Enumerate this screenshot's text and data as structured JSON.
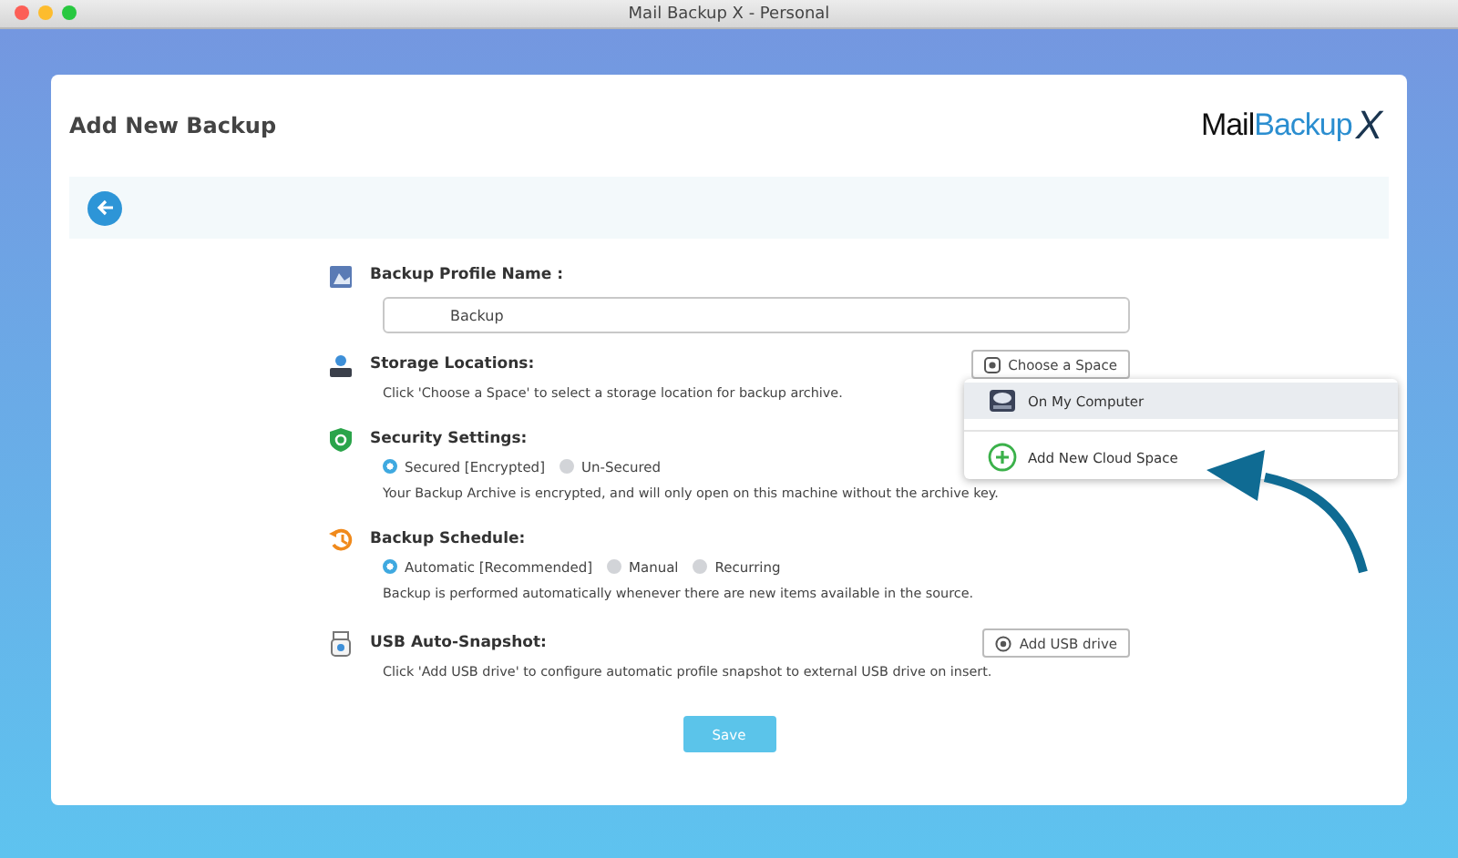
{
  "window": {
    "title": "Mail Backup X - Personal"
  },
  "page": {
    "title": "Add New Backup",
    "logo": {
      "part_1": "Mail",
      "part_2": "Backup",
      "part_3": "X"
    }
  },
  "sections": [
    {
      "kind": "name",
      "title": "Backup Profile Name :",
      "field_value": "Backup"
    },
    {
      "kind": "storage",
      "title": "Storage Locations:",
      "button": "Choose a Space",
      "description": "Click 'Choose a Space' to select a storage location for backup archive.",
      "menu": [
        {
          "kind": "computer",
          "label": "On My Computer",
          "selected": true
        },
        {
          "kind": "cloud",
          "label": "Add New Cloud Space",
          "selected": false
        }
      ]
    },
    {
      "kind": "security",
      "title": "Security Settings:",
      "options": [
        {
          "label": "Secured [Encrypted]",
          "selected": true
        },
        {
          "label": "Un-Secured",
          "selected": false
        }
      ],
      "description": "Your Backup Archive is encrypted, and will only open on this machine without the archive key."
    },
    {
      "kind": "schedule",
      "title": "Backup Schedule:",
      "options": [
        {
          "label": "Automatic [Recommended]",
          "selected": true
        },
        {
          "label": "Manual",
          "selected": false
        },
        {
          "label": "Recurring",
          "selected": false
        }
      ],
      "description": "Backup is performed automatically whenever there are new items available in the source."
    },
    {
      "kind": "usb",
      "title": "USB Auto-Snapshot:",
      "button": "Add USB drive",
      "description": "Click 'Add USB drive' to configure automatic profile snapshot to external USB drive on insert."
    }
  ],
  "save_button": "Save"
}
